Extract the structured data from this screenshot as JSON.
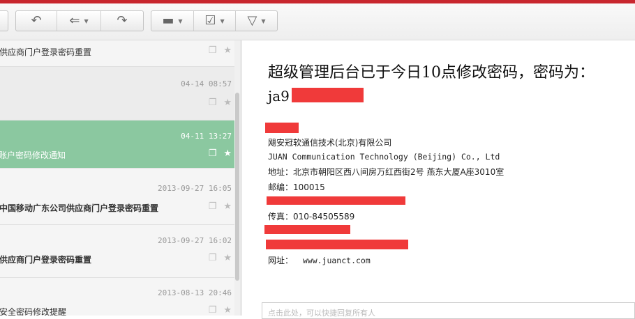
{
  "toolbar": {
    "buttons": [
      "back-arrow-icon",
      "reply-icon",
      "reply-all-icon",
      "forward-icon",
      "folder-icon",
      "checkbox-icon",
      "filter-icon"
    ]
  },
  "list": {
    "items": [
      {
        "date": "",
        "subject": "供应商门户登录密码重置"
      },
      {
        "date": "04-14 08:57",
        "subject": ""
      },
      {
        "date": "04-11 13:27",
        "subject": "账户密码修改通知"
      },
      {
        "date": "2013-09-27 16:05",
        "subject": "中国移动广东公司供应商门户登录密码重置"
      },
      {
        "date": "2013-09-27 16:02",
        "subject": "供应商门户登录密码重置"
      },
      {
        "date": "2013-08-13 20:46",
        "subject": "安全密码修改提醒"
      }
    ]
  },
  "reader": {
    "heading": "超级管理后台已于今日10点修改密码，密码为：",
    "password_prefix": "ja9",
    "company_cn": "飓安冠软通信技术(北京)有限公司",
    "company_en": "JUAN Communication Technology (Beijing) Co., Ltd",
    "address": "地址：北京市朝阳区西八间房万红西街2号 燕东大厦A座3010室",
    "postcode": "邮编：100015",
    "fax": "传真：010-84505589",
    "website_label": "网址：",
    "website": "www.juanct.com"
  },
  "reply_box": {
    "placeholder": "点击此处，可以快捷回复所有人"
  },
  "colors": {
    "accent": "#c8262e",
    "selected_row": "#8bc8a0",
    "redaction": "#f03a3a"
  }
}
